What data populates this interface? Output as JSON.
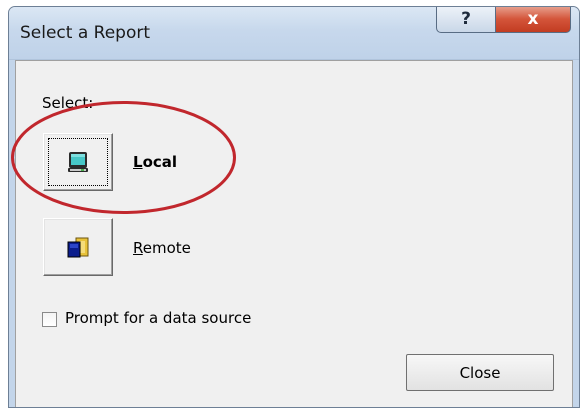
{
  "window": {
    "title": "Select a Report",
    "help_glyph": "?",
    "close_glyph": "x"
  },
  "dialog": {
    "select_label": "Select:",
    "options": [
      {
        "label": "Local",
        "icon": "computer-icon",
        "focused": true,
        "highlighted": true
      },
      {
        "label": "Remote",
        "icon": "folder-icon",
        "focused": false,
        "highlighted": false
      }
    ],
    "prompt_checkbox": {
      "label": "Prompt for a data source",
      "checked": false
    },
    "close_button_label": "Close"
  },
  "colors": {
    "highlight_ellipse": "#c1272d",
    "title_close_button": "#c9452a"
  }
}
